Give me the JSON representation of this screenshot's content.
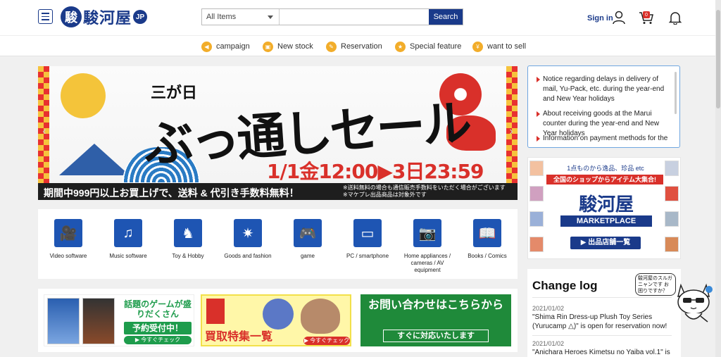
{
  "header": {
    "logo_text": "駿河屋",
    "logo_mark": "駿",
    "logo_suffix": "JP",
    "search_category": "All Items",
    "search_placeholder": "",
    "search_button": "Search",
    "signin": "Sign in",
    "cart_count": "0"
  },
  "nav": [
    {
      "label": "campaign",
      "icon": "megaphone-icon"
    },
    {
      "label": "New stock",
      "icon": "box-icon"
    },
    {
      "label": "Reservation",
      "icon": "pencil-icon"
    },
    {
      "label": "Special feature",
      "icon": "badge-icon"
    },
    {
      "label": "want to sell",
      "icon": "coin-icon"
    }
  ],
  "banner": {
    "sub": "三が日",
    "main": "ぶっ通しセール",
    "date": "1/1金12:00▶3日23:59",
    "strip": "期間中999円以上お買上げで、送料 & 代引き手数料無料！",
    "strip_note1": "※送料無料の場合も通信販売手数料をいただく場合がございます",
    "strip_note2": "※マケプレ出品商品は対象外です"
  },
  "categories": [
    {
      "label": "Video software",
      "icon": "video-camera-icon",
      "glyph": "🎥"
    },
    {
      "label": "Music software",
      "icon": "music-note-icon",
      "glyph": "♫"
    },
    {
      "label": "Toy & Hobby",
      "icon": "monster-icon",
      "glyph": "♞"
    },
    {
      "label": "Goods and fashion",
      "icon": "star-badge-icon",
      "glyph": "✷"
    },
    {
      "label": "game",
      "icon": "gamepad-icon",
      "glyph": "🎮"
    },
    {
      "label": "PC / smartphone",
      "icon": "devices-icon",
      "glyph": "▭"
    },
    {
      "label": "Home appliances / cameras / AV equipment",
      "icon": "camera-icon",
      "glyph": "📷"
    },
    {
      "label": "Books / Comics",
      "icon": "book-icon",
      "glyph": "📖"
    }
  ],
  "promos": {
    "p1_text": "話題のゲームが盛りだくさん",
    "p1_btn": "予約受付中！",
    "p1_check": "▶ 今すぐチェック",
    "p2_title": "買取特集一覧",
    "p2_check": "▶ 今すぐチェック",
    "p3_text": "お問い合わせはこちらから",
    "p3_btn": "すぐに対応いたします"
  },
  "notices": [
    "Notice regarding delays in delivery of mail, Yu-Pack, etc. during the year-end and New Year holidays",
    "About receiving goods at the Marui counter during the year-end and New Year holidays",
    "Information on payment methods for the"
  ],
  "market": {
    "top": "1点ものから逸品、珍品 etc",
    "red": "全国のショップからアイテム大集合!",
    "logo": "駿河屋",
    "sub": "MARKETPLACE",
    "button": "▶ 出品店舗一覧"
  },
  "changelog": {
    "title": "Change log",
    "entries": [
      {
        "date": "2021/01/02",
        "text": "\"Shima Rin Dress-up Plush Toy Series (Yurucamp △)\" is open for reservation now!"
      },
      {
        "date": "2021/01/02",
        "text": "\"Anichara Heroes Kimetsu no Yaiba vol.1\" is"
      }
    ]
  },
  "mascot_bubble": "駿河屋のスルガニャンです お困りですか？",
  "colors": {
    "brand": "#1a3a8a",
    "accent": "#d9302a",
    "nav_icon": "#f2ad2a",
    "category": "#1e55b3"
  }
}
